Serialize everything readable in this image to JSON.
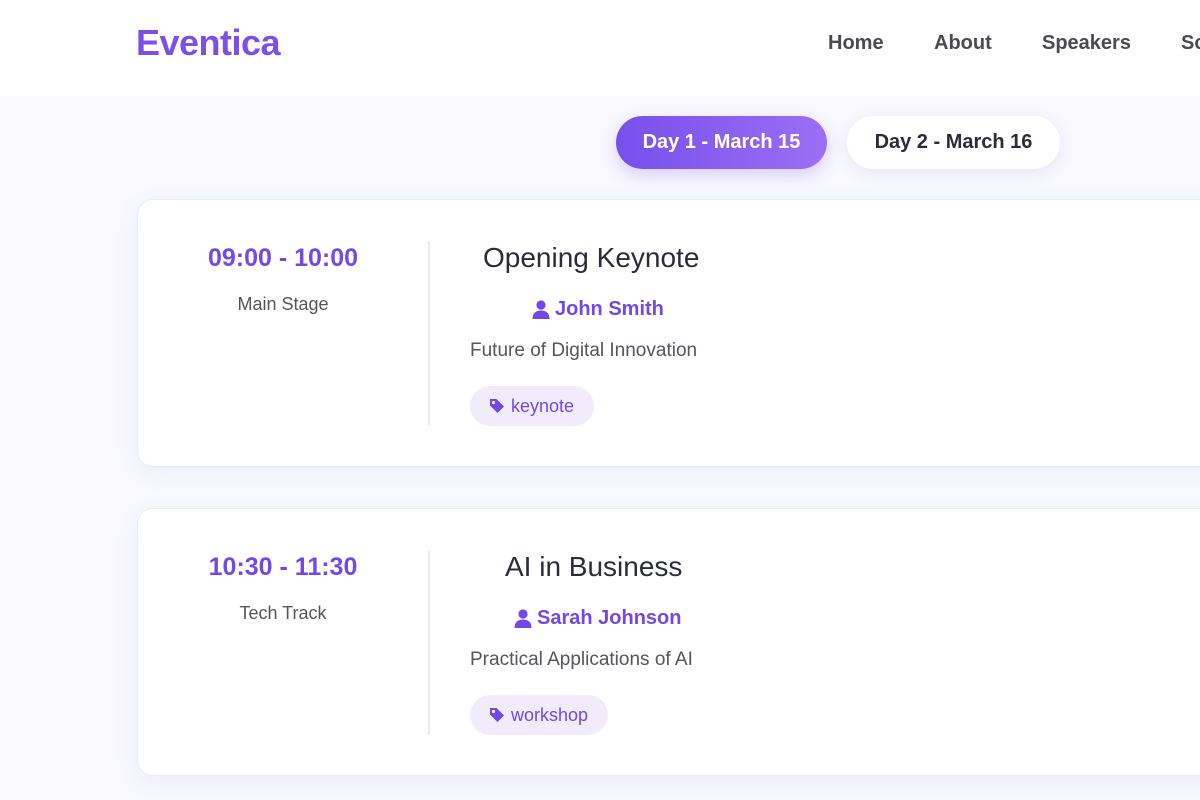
{
  "header": {
    "logo": "Eventica",
    "nav": [
      "Home",
      "About",
      "Speakers",
      "Schedule"
    ]
  },
  "day_tabs": {
    "day1": "Day 1 - March 15",
    "day2": "Day 2 - March 16"
  },
  "sessions": [
    {
      "time": "09:00 - 10:00",
      "venue": "Main Stage",
      "title": "Opening Keynote",
      "speaker": "John Smith",
      "description": "Future of Digital Innovation",
      "tag": "keynote"
    },
    {
      "time": "10:30 - 11:30",
      "venue": "Tech Track",
      "title": "AI in Business",
      "speaker": "Sarah Johnson",
      "description": "Practical Applications of AI",
      "tag": "workshop"
    }
  ],
  "colors": {
    "accent": "#7348e6",
    "tag_bg": "#f1ecfc",
    "background": "#f8f8fe"
  },
  "icons": {
    "speaker": "user-icon",
    "tag": "tag-icon"
  }
}
